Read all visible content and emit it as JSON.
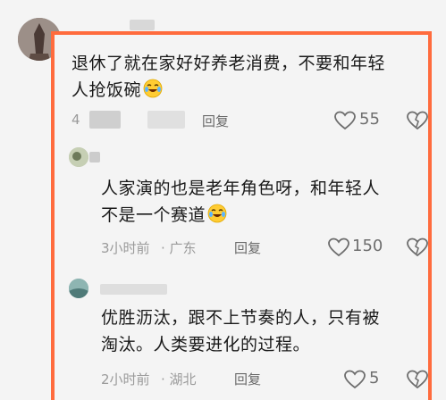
{
  "comment": {
    "text_line1": "退休了就在家好好养老消费，不要和年轻",
    "text_line2": "人抢饭碗",
    "meta_left": "4",
    "reply_label": "回复",
    "like_count": "55"
  },
  "replies": [
    {
      "text_line1": "人家演的也是老年角色呀，和年轻人",
      "text_line2": "不是一个赛道",
      "time": "3小时前",
      "location": "· 广东",
      "reply_label": "回复",
      "like_count": "150"
    },
    {
      "text_line1": "优胜沥汰，跟不上节奏的人，只有被",
      "text_line2": "淘汰。人类要进化的过程。",
      "time": "2小时前",
      "location": "· 湖北",
      "reply_label": "回复",
      "like_count": "5"
    }
  ],
  "colors": {
    "highlight_border": "#ff6b3d",
    "background": "#f4f4f4"
  },
  "icons": [
    "heart-icon",
    "broken-heart-icon",
    "laughing-crying-emoji"
  ]
}
